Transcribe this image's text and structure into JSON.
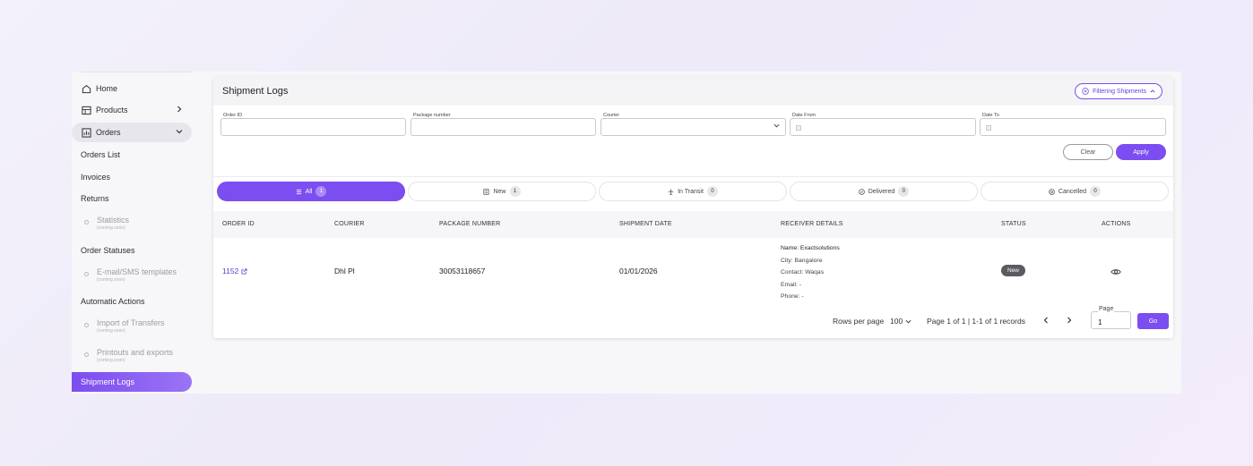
{
  "sidebar": {
    "home": "Home",
    "products": "Products",
    "orders": "Orders",
    "orders_list": "Orders List",
    "invoices": "Invoices",
    "returns": "Returns",
    "statistics": "Statistics",
    "statistics_note": "(coming soon)",
    "order_statuses": "Order Statuses",
    "email_sms": "E-mail/SMS templates",
    "email_sms_note": "(coming soon)",
    "automatic_actions": "Automatic Actions",
    "import_transfers": "Import of Transfers",
    "import_transfers_note": "(coming soon)",
    "printouts": "Printouts and exports",
    "printouts_note": "(coming soon)",
    "shipment_logs": "Shipment Logs"
  },
  "card": {
    "title": "Shipment Logs",
    "filter_button": "Filtering Shipments"
  },
  "filters": {
    "order_id": "Order ID",
    "package_number": "Package number",
    "courier": "Courier",
    "date_from": "Date From",
    "date_to": "Date To",
    "clear": "Clear",
    "apply": "Apply"
  },
  "tabs": [
    {
      "label": "All",
      "count": "1"
    },
    {
      "label": "New",
      "count": "1"
    },
    {
      "label": "In Transit",
      "count": "0"
    },
    {
      "label": "Delivered",
      "count": "0"
    },
    {
      "label": "Cancelled",
      "count": "0"
    }
  ],
  "table": {
    "headers": [
      "ORDER ID",
      "COURIER",
      "PACKAGE NUMBER",
      "SHIPMENT DATE",
      "RECEIVER DETAILS",
      "STATUS",
      "ACTIONS"
    ],
    "rows": [
      {
        "order_id": "1152",
        "courier": "Dhl Pl",
        "package_number": "30053118657",
        "shipment_date": "01/01/2026",
        "receiver_name": "Name: Exactsolutions",
        "receiver_city": "City: Bangalore",
        "receiver_contact": "Contact: Waqas",
        "receiver_email": "Email: -",
        "receiver_phone": "Phone: -",
        "status": "New"
      }
    ]
  },
  "pagination": {
    "rows_per_page_label": "Rows per page",
    "rows_per_page_value": "100",
    "summary": "Page 1 of 1 | 1-1 of 1 records",
    "page_label": "Page",
    "page_value": "1",
    "go": "Go"
  },
  "colors": {
    "accent": "#7c4df0",
    "status_new": "#5a5a60"
  }
}
